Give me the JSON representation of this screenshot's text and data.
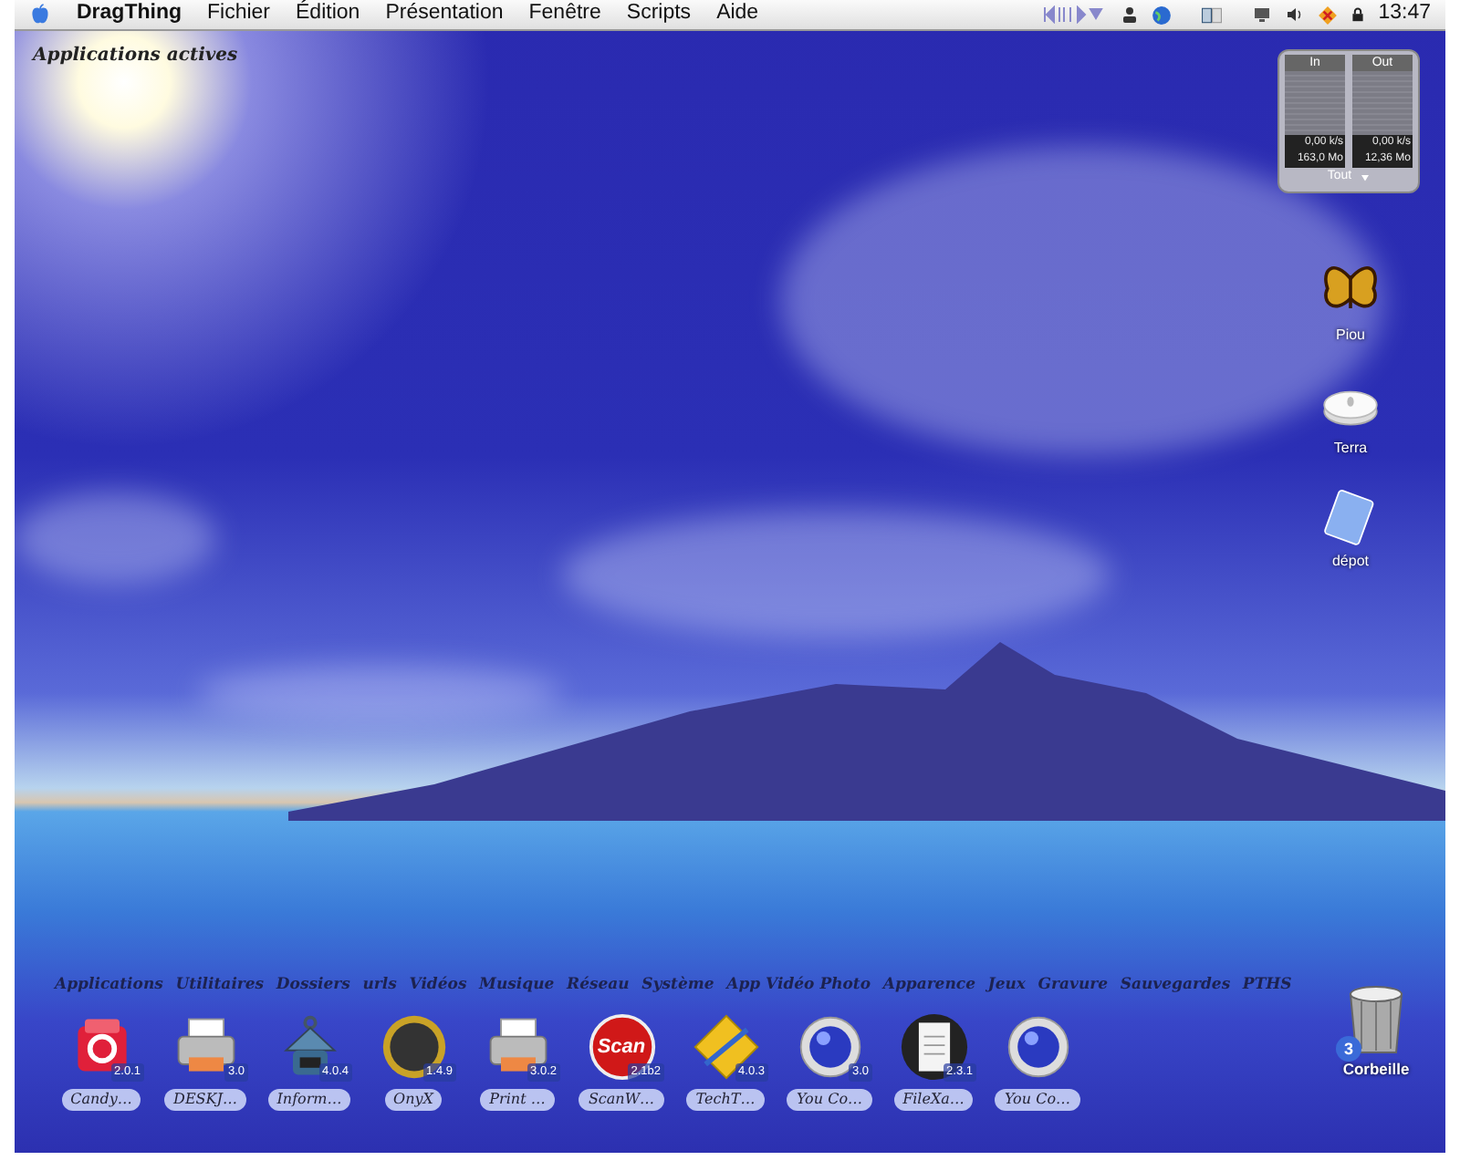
{
  "menu_bar": {
    "app_name": "DragThing",
    "menus": [
      "Fichier",
      "Édition",
      "Présentation",
      "Fenêtre",
      "Scripts",
      "Aide"
    ],
    "clock": "13:47"
  },
  "dock_title": "Applications actives",
  "network_monitor": {
    "columns": [
      {
        "label": "In",
        "rate": "0,00 k/s",
        "total": "163,0 Mo"
      },
      {
        "label": "Out",
        "rate": "0,00 k/s",
        "total": "12,36 Mo"
      }
    ],
    "filter": "Tout"
  },
  "desktop_icons": [
    {
      "label": "Piou",
      "kind": "butterfly"
    },
    {
      "label": "Terra",
      "kind": "disk"
    },
    {
      "label": "dépot",
      "kind": "document"
    }
  ],
  "dock": {
    "tabs": [
      "Applications",
      "Utilitaires",
      "Dossiers",
      "urls",
      "Vidéos",
      "Musique",
      "Réseau",
      "Système",
      "App Vidéo Photo",
      "Apparence",
      "Jeux",
      "Gravure",
      "Sauvegardes",
      "PTHS"
    ],
    "items": [
      {
        "label": "Candy…",
        "version": "2.0.1",
        "kind": "candy"
      },
      {
        "label": "DESKJ…",
        "version": "3.0",
        "kind": "printer"
      },
      {
        "label": "Inform…",
        "version": "4.0.4",
        "kind": "chip"
      },
      {
        "label": "OnyX",
        "version": "1.4.9",
        "kind": "ring"
      },
      {
        "label": "Print …",
        "version": "3.0.2",
        "kind": "printer"
      },
      {
        "label": "ScanW…",
        "version": "2.1b2",
        "kind": "scan",
        "icon_text": "Scan"
      },
      {
        "label": "TechT…",
        "version": "4.0.3",
        "kind": "diamond"
      },
      {
        "label": "You Co…",
        "version": "3.0",
        "kind": "sphere"
      },
      {
        "label": "FileXa…",
        "version": "2.3.1",
        "kind": "document"
      },
      {
        "label": "You Co…",
        "kind": "sphere"
      }
    ]
  },
  "trash": {
    "label": "Corbeille",
    "count": "3"
  }
}
